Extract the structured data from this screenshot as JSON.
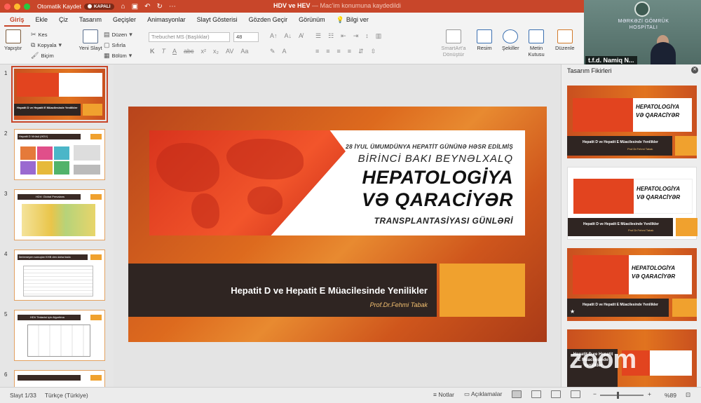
{
  "titlebar": {
    "autosave_label": "Otomatik Kaydet",
    "autosave_state": "KAPALI",
    "doc_name": "HDV ve HEV",
    "doc_status": "— Mac'im konumuna kaydedildi"
  },
  "tabs": [
    "Giriş",
    "Ekle",
    "Çiz",
    "Tasarım",
    "Geçişler",
    "Animasyonlar",
    "Slayt Gösterisi",
    "Gözden Geçir",
    "Görünüm",
    "Bilgi ver"
  ],
  "ribbon": {
    "paste": "Yapıştır",
    "cut": "Kes",
    "copy": "Kopyala",
    "format": "Biçim",
    "new_slide": "Yeni Slayt",
    "layout": "Düzen",
    "reset": "Sıfırla",
    "section": "Bölüm",
    "font_name": "Trebuchet MS (Başlıklar)",
    "font_size": "48",
    "smartart": "SmartArt'a Dönüştür",
    "picture": "Resim",
    "shapes": "Şekiller",
    "textbox": "Metin Kutusu",
    "arrange": "Düzenle"
  },
  "video": {
    "org_text": "MƏRKƏZİ GÖMRÜK HOSPİTALI",
    "participant": "t.f.d. Namiq N..."
  },
  "thumbs": [
    {
      "num": "1",
      "title": "Hepatit D ve Hepatit E Müacilesinde Yenilikler"
    },
    {
      "num": "2",
      "title": "Hepatit D Virüsü (HDV)"
    },
    {
      "num": "3",
      "title": "HDV: Global Prevalans"
    },
    {
      "num": "4",
      "title": "İlerlemeyen sonuçlar KHB den daha fazla"
    },
    {
      "num": "5",
      "title": "HDV Tedavisi için Algoritma"
    },
    {
      "num": "6",
      "title": ""
    }
  ],
  "slide": {
    "line1": "28 İYUL ÜMUMDÜNYA HEPATİT GÜNÜNƏ HƏSR EDİLMİŞ",
    "line2": "BİRİNCİ BAKI BEYNƏLXALQ",
    "line3": "HEPATOLOGİYA",
    "line4": "VƏ QARACİYƏR",
    "line5": "TRANSPLANTASİYASI GÜNLƏRİ",
    "subtitle": "Hepatit D ve Hepatit E Müacilesinde Yenilikler",
    "author": "Prof.Dr.Fehmi Tabak"
  },
  "design": {
    "title": "Tasarım Fikirleri",
    "thumb_sub": "Hepatit D ve Hepatit E Müacilesinde Yenilikler",
    "thumb_author": "Prof.Dr.Fehmi Tabak",
    "last_sub": "Hepatit D ve Hepatit E Müacilesinde Yenilikler"
  },
  "status": {
    "slide_pos": "Slayt 1/33",
    "language": "Türkçe (Türkiye)",
    "notes": "Notlar",
    "comments": "Açıklamalar",
    "zoom": "%89"
  },
  "watermark": "zoom",
  "colors": {
    "accent": "#c8462a",
    "slide_orange": "#dd6a1e",
    "slide_dark": "#2f2522",
    "slide_yellow": "#f0a12e"
  }
}
